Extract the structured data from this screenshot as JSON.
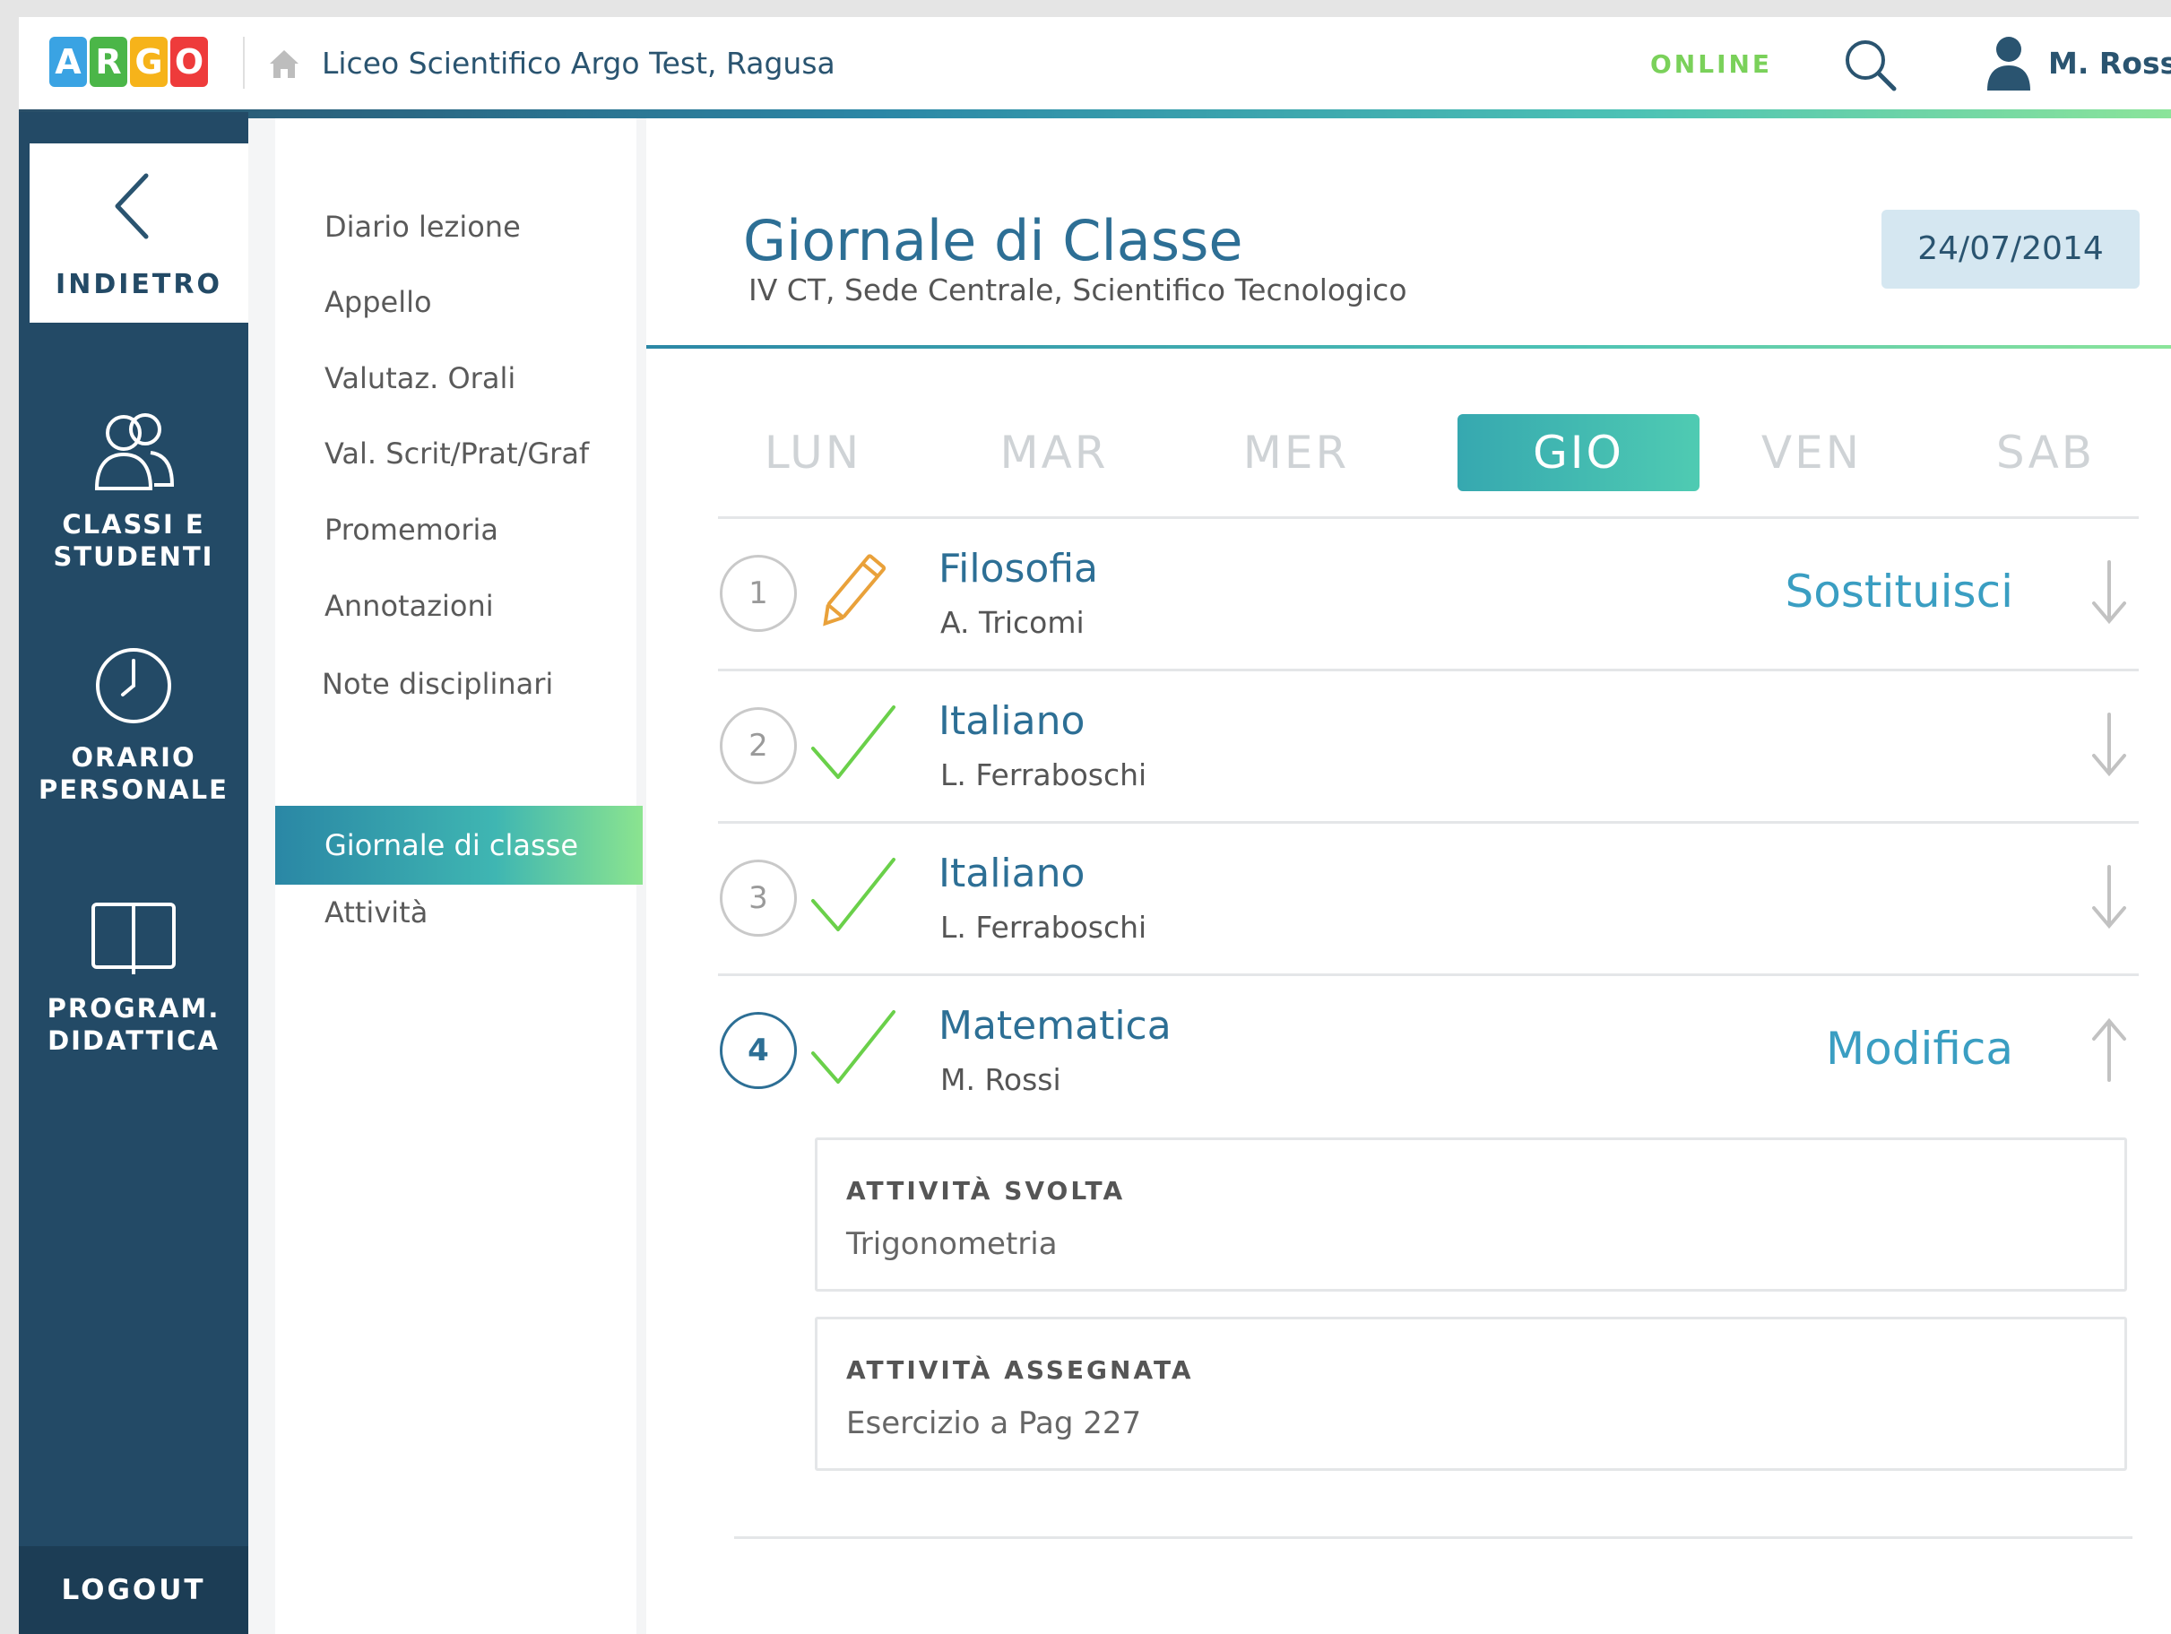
{
  "header": {
    "logo_letters": [
      {
        "char": "A",
        "color": "#3aa3e3"
      },
      {
        "char": "R",
        "color": "#4bb648"
      },
      {
        "char": "G",
        "color": "#f6b31a"
      },
      {
        "char": "O",
        "color": "#ee3b3b"
      }
    ],
    "school_name": "Liceo Scientifico Argo Test, Ragusa",
    "status": "ONLINE",
    "user_name": "M. Rossi"
  },
  "sidebar": {
    "back_label": "INDIETRO",
    "items": [
      {
        "label_line1": "CLASSI E",
        "label_line2": "STUDENTI",
        "icon": "users-icon"
      },
      {
        "label_line1": "ORARIO",
        "label_line2": "PERSONALE",
        "icon": "clock-icon"
      },
      {
        "label_line1": "PROGRAM.",
        "label_line2": "DIDATTICA",
        "icon": "book-icon"
      }
    ],
    "logout_label": "LOGOUT"
  },
  "submenu": {
    "items": [
      "Diario lezione",
      "Appello",
      "Valutaz. Orali",
      "Val. Scrit/Prat/Graf",
      "Promemoria",
      "Annotazioni",
      "Note disciplinari",
      "Giornale di classe",
      "Attività"
    ],
    "active_index": 7
  },
  "main": {
    "title": "Giornale di Classe",
    "subtitle": "IV CT, Sede Centrale, Scientifico Tecnologico",
    "date": "24/07/2014",
    "days": [
      "LUN",
      "MAR",
      "MER",
      "GIO",
      "VEN",
      "SAB"
    ],
    "active_day": "GIO",
    "lessons": [
      {
        "number": "1",
        "subject": "Filosofia",
        "teacher": "A. Tricomi",
        "status": "pencil-icon",
        "action": "Sostituisci",
        "expanded": false
      },
      {
        "number": "2",
        "subject": "Italiano",
        "teacher": "L. Ferraboschi",
        "status": "check-icon",
        "action": "",
        "expanded": false
      },
      {
        "number": "3",
        "subject": "Italiano",
        "teacher": "L. Ferraboschi",
        "status": "check-icon",
        "action": "",
        "expanded": false
      },
      {
        "number": "4",
        "subject": "Matematica",
        "teacher": "M. Rossi",
        "status": "check-icon",
        "action": "Modifica",
        "expanded": true
      }
    ],
    "details": [
      {
        "label": "ATTIVITÀ SVOLTA",
        "value": "Trigonometria"
      },
      {
        "label": "ATTIVITÀ ASSEGNATA",
        "value": "Esercizio a Pag 227"
      }
    ]
  },
  "colors": {
    "sidebar": "#234a66",
    "accent": "#2d6f95",
    "online": "#7ad15a",
    "check": "#6ad04a",
    "pencil": "#e9a13a"
  }
}
